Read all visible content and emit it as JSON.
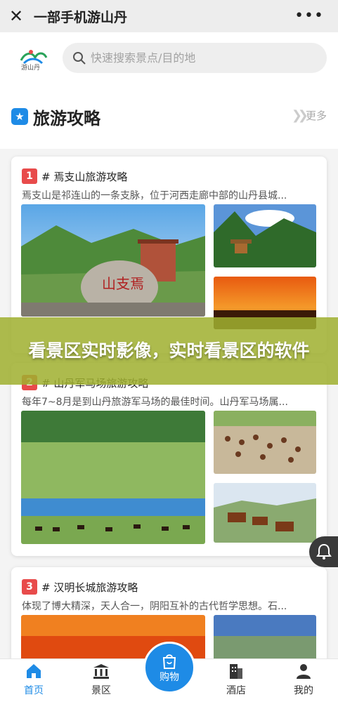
{
  "topbar": {
    "title": "一部手机游山丹",
    "close_icon": "close-icon",
    "more_icon": "more-dots-icon"
  },
  "header": {
    "logo_text": "游山丹",
    "search_placeholder": "快速搜索景点/目的地"
  },
  "section": {
    "title": "旅游攻略",
    "more": "更多"
  },
  "cards": [
    {
      "num": "1",
      "title": "# 焉支山旅游攻略",
      "desc": "焉支山是祁连山的一条支脉，位于河西走廊中部的山丹县城..."
    },
    {
      "num": "2",
      "title": "# 山丹军马场旅游攻略",
      "desc": "每年7~8月是到山丹旅游军马场的最佳时间。山丹军马场属..."
    },
    {
      "num": "3",
      "title": "# 汉明长城旅游攻略",
      "desc": "体现了博大精深，天人合一，阴阳互补的古代哲学思想。石..."
    }
  ],
  "banner": {
    "text": "看景区实时影像，实时看景区的软件"
  },
  "image_text": {
    "stone": "山支焉"
  },
  "tabs": [
    {
      "label": "首页",
      "icon": "home-icon"
    },
    {
      "label": "景区",
      "icon": "scenic-icon"
    },
    {
      "label": "购物",
      "icon": "shopping-bag-icon"
    },
    {
      "label": "酒店",
      "icon": "hotel-icon"
    },
    {
      "label": "我的",
      "icon": "user-icon"
    }
  ],
  "colors": {
    "accent": "#1e8be6",
    "badge": "#e84b4b",
    "banner": "#a0b030"
  }
}
